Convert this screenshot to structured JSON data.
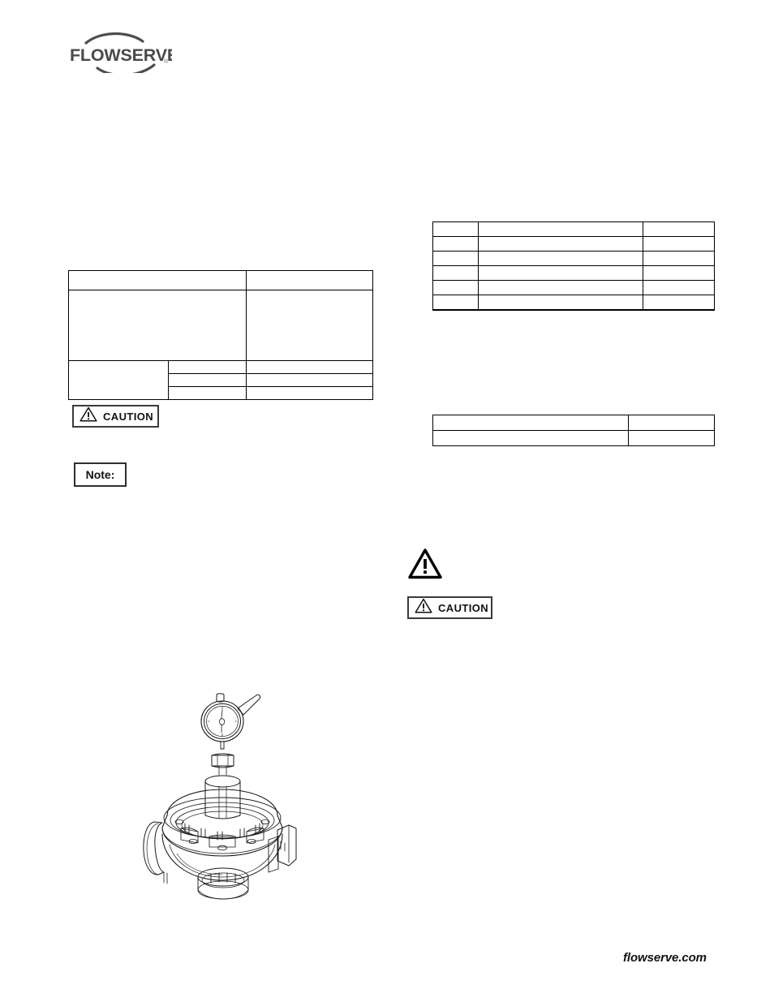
{
  "document": {
    "brand": "FLOWSERVE",
    "brand_registered_mark": "®",
    "footer_url": "flowserve.com"
  },
  "callouts": {
    "caution_left": {
      "icon": "warning-triangle-icon",
      "label": "CAUTION"
    },
    "caution_right": {
      "icon": "warning-triangle-icon",
      "label": "CAUTION"
    },
    "warning_triangle": {
      "icon": "warning-triangle-icon"
    },
    "note": {
      "label": "Note:"
    }
  },
  "tables": {
    "spec_table": {
      "rows": [
        {
          "cells": [
            {
              "text": "",
              "colspan": 2
            },
            {
              "text": ""
            }
          ]
        },
        {
          "cells": [
            {
              "text": "",
              "colspan": 2
            },
            {
              "text": ""
            }
          ]
        },
        {
          "cells": [
            {
              "text": "",
              "rowspan": 3
            },
            {
              "text": ""
            },
            {
              "text": ""
            }
          ]
        },
        {
          "cells": [
            {
              "text": ""
            },
            {
              "text": ""
            }
          ]
        },
        {
          "cells": [
            {
              "text": ""
            },
            {
              "text": ""
            }
          ]
        }
      ]
    },
    "parts_table": {
      "rows": [
        {
          "cells": [
            {
              "text": ""
            },
            {
              "text": ""
            },
            {
              "text": ""
            }
          ]
        },
        {
          "cells": [
            {
              "text": ""
            },
            {
              "text": ""
            },
            {
              "text": ""
            }
          ]
        },
        {
          "cells": [
            {
              "text": ""
            },
            {
              "text": ""
            },
            {
              "text": ""
            }
          ]
        },
        {
          "cells": [
            {
              "text": ""
            },
            {
              "text": ""
            },
            {
              "text": ""
            }
          ]
        },
        {
          "cells": [
            {
              "text": ""
            },
            {
              "text": ""
            },
            {
              "text": ""
            }
          ]
        },
        {
          "cells": [
            {
              "text": ""
            },
            {
              "text": ""
            },
            {
              "text": ""
            }
          ]
        }
      ]
    },
    "torque_table": {
      "rows": [
        {
          "cells": [
            {
              "text": ""
            },
            {
              "text": ""
            }
          ]
        },
        {
          "cells": [
            {
              "text": ""
            },
            {
              "text": ""
            }
          ]
        }
      ]
    }
  },
  "figure": {
    "name": "valve-actuator-assembly-with-dial-indicator",
    "caption": ""
  }
}
